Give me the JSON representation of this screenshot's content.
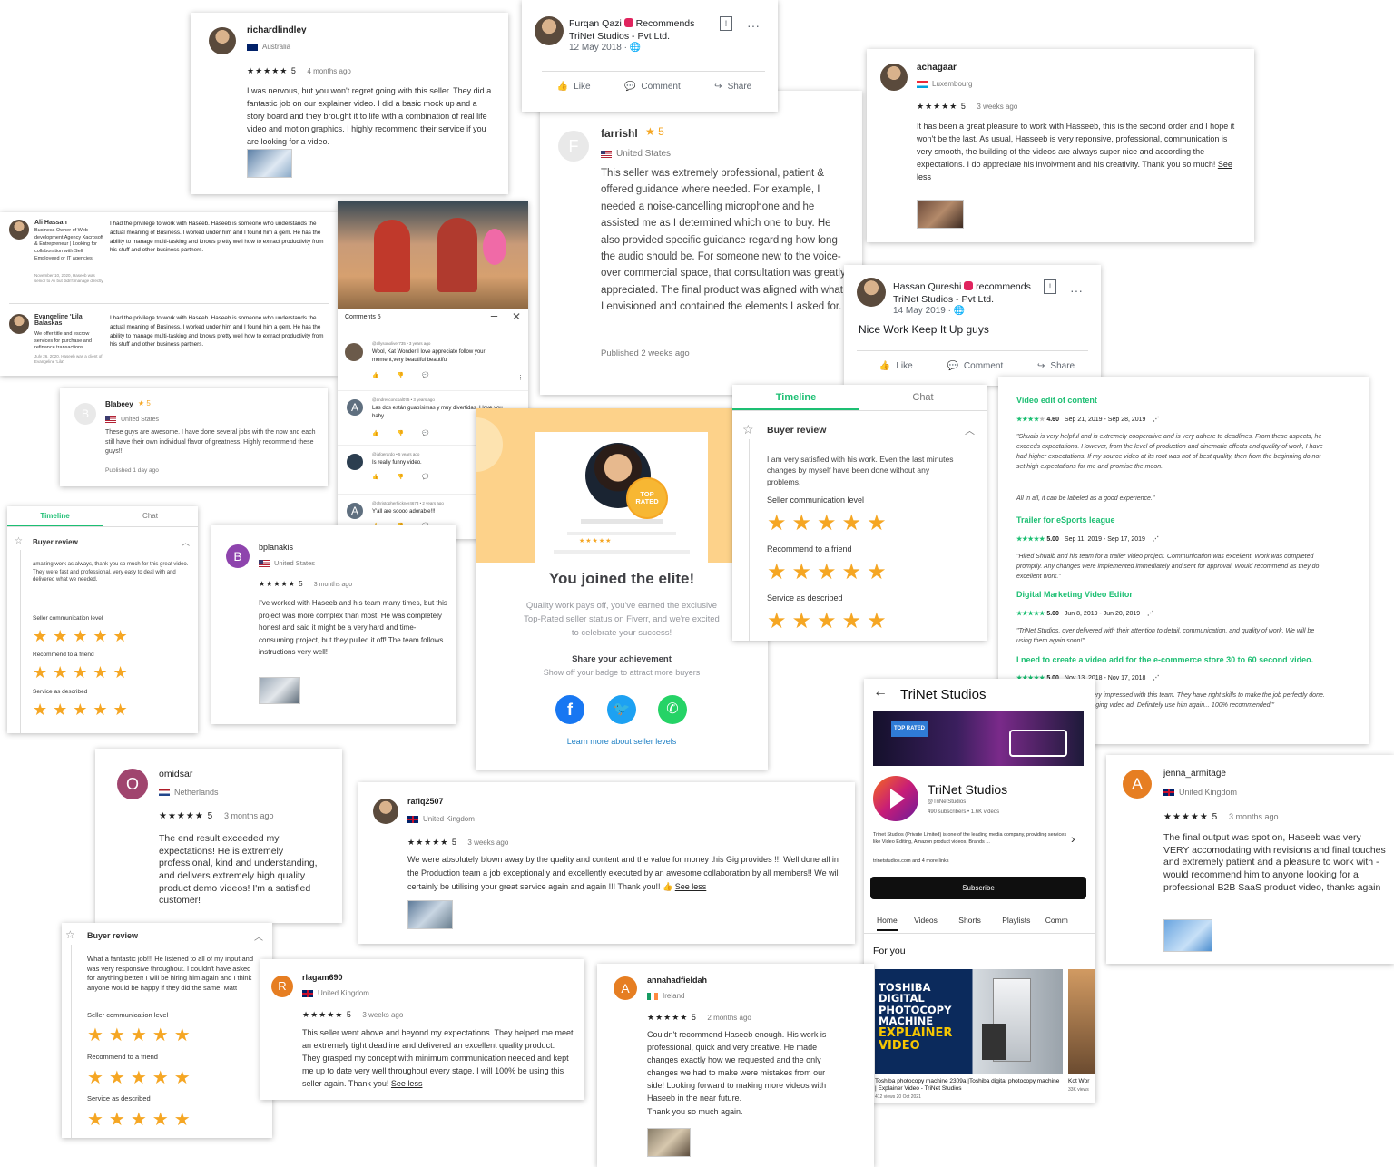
{
  "cards": {
    "richard": {
      "name": "richardlindley",
      "country": "Australia",
      "rating": "5",
      "when": "4 months ago",
      "text": "I was nervous, but you won't regret going with this seller. They did a fantastic job on our explainer video. I did a basic mock up and a story board and they brought it to life with a combination of real life video and motion graphics. I highly recommend their service if you are looking for a video."
    },
    "furqan": {
      "name": "Furqan Qazi",
      "recommends": "Recommends",
      "page": "TriNet Studios - Pvt Ltd.",
      "date": "12 May 2018",
      "like": "Like",
      "comment": "Comment",
      "share": "Share"
    },
    "achagaar": {
      "name": "achagaar",
      "country": "Luxembourg",
      "rating": "5",
      "when": "3 weeks ago",
      "text": "It has been a great pleasure to work with Hasseeb, this is the second order and I hope it won't be the last. As usual, Hasseeb is very reponsive, professional, communication is very smooth, the building of the videos are always super nice and according the expectations. I do appreciate his involvment and his creativity. Thank you so much!",
      "see_less": "See less"
    },
    "farrishl": {
      "avatar": "F",
      "name": "farrishl",
      "rating": "5",
      "country": "United States",
      "text": "This seller was extremely professional, patient & offered guidance where needed. For example, I needed a noise-cancelling microphone and he assisted me as I determined which one to buy. He also provided specific guidance regarding how long the audio should be. For someone new to the voice-over commercial space, that consultation was greatly appreciated. The final product was aligned with what I envisioned and contained the elements I asked for.",
      "published": "Published 2 weeks ago"
    },
    "linkedin": {
      "r1_name": "Ali Hassan",
      "r1_title": "Business Owner of Web development Agency Xacrosoft & Entrepreneur | Looking for collaboration with Self Employeed or IT agencies",
      "r1_meta": "November 10, 2020, Haseeb was senior to Ali but didn't manage directly",
      "r1_text": "I had the privilege to work with Haseeb. Haseeb is someone who understands the actual meaning of Business. I worked under him and I found him a gem. He has the ability to manage multi-tasking and knows pretty well how to extract productivity from his stuff and other business partners.",
      "r2_name": "Evangeline 'Lila' Balaskas",
      "r2_title": "We offer title and escrow services for purchase and refinance transactions.",
      "r2_meta": "July 26, 2020, Haseeb was a client of Evangeline 'Lila'",
      "r2_text": "I had the privilege to work with Haseeb. Haseeb is someone who understands the actual meaning of Business. I worked under him and I found him a gem. He has the ability to manage multi-tasking and knows pretty well how to extract productivity from his stuff and other business partners."
    },
    "comments": {
      "header": "Comments",
      "count": "5",
      "items": [
        {
          "user": "@allysonoliver735 • 3 years ago",
          "text": "Wool, Kat Wonder I love appreciate follow your moment,very beautiful beautiful"
        },
        {
          "user": "@andresconcoal075 • 3 years ago",
          "text": "Las dos están guapísimas y muy divertidas. I love you baby"
        },
        {
          "user": "@jafgerardo • 5 years ago",
          "text": "Is really funny video."
        },
        {
          "user": "@christopherhickner4673 • 2 years ago",
          "text": "Y'all are soooo adorable!!!"
        }
      ]
    },
    "hassan": {
      "name": "Hassan Qureshi",
      "recommends": "recommends",
      "page": "TriNet Studios - Pvt Ltd.",
      "date": "14 May 2019",
      "text": "Nice Work Keep It Up guys",
      "like": "Like",
      "comment": "Comment",
      "share": "Share"
    },
    "blabeey": {
      "avatar": "B",
      "name": "Blabeey",
      "rating": "5",
      "country": "United States",
      "text": "These guys are awesome. I have done several jobs with the now and each still have their own individual flavor of greatness. Highly recommend these guys!!",
      "published": "Published 1 day ago"
    },
    "fiverr_small": {
      "tab_timeline": "Timeline",
      "tab_chat": "Chat",
      "section": "Buyer review",
      "text": "amazing work as always, thank you so much for this great video. They were fast and professional, very easy to deal with and delivered what we needed.",
      "l1": "Seller communication level",
      "l2": "Recommend to a friend",
      "l3": "Service as described"
    },
    "bplanakis": {
      "avatar": "B",
      "name": "bplanakis",
      "country": "United States",
      "rating": "5",
      "when": "3 months ago",
      "text": "I've worked with Haseeb and his team many times, but this project was more complex than most. He was completely honest and said it might be a very hard and time-consuming project, but they pulled it off! The team follows instructions very well!"
    },
    "elite": {
      "badge": "TOP RATED",
      "title": "You joined the elite!",
      "desc": "Quality work pays off, you've earned the exclusive Top-Rated seller status on Fiverr, and we're excited to celebrate your success!",
      "share_title": "Share your achievement",
      "share_desc": "Show off your badge to attract more buyers",
      "learn": "Learn more about seller levels"
    },
    "fiverr_big": {
      "tab_timeline": "Timeline",
      "tab_chat": "Chat",
      "section": "Buyer review",
      "text": "I am very satisfied with his work. Even the last minutes changes by myself have been done without any problems.",
      "l1": "Seller communication level",
      "l2": "Recommend to a friend",
      "l3": "Service as described"
    },
    "upwork": {
      "t1": "Video edit of content",
      "s1": "4.60",
      "d1": "Sep 21, 2019 - Sep 28, 2019",
      "r1": "\"Shuaib is very helpful and is extremely cooperative and is very adhere to deadlines. From these aspects, he exceeds expectations. However, from the level of production and cinematic effects and quality of work, I have had higher expectations. If my source video at its root was not of best quality, then from the beginning do not set high expectations for me and promise the moon.",
      "r1b": "All in all, it can be labeled as a good experience.\"",
      "t2": "Trailer for eSports league",
      "s2": "5.00",
      "d2": "Sep 11, 2019 - Sep 17, 2019",
      "r2": "\"Hired Shuaib and his team for a trailer video project. Communication was excellent. Work was completed promptly. Any changes were implemented immediately and sent for approval. Would recommend as they do excellent work.\"",
      "t3": "Digital Marketing Video Editor",
      "s3": "5.00",
      "d3": "Jun 8, 2019 - Jun 20, 2019",
      "r3": "\"TriNet Studios, over delivered with their attention to detail, communication, and quality of work. We will be using them again soon!\"",
      "t4": "I need to create a video add for the e-commerce store 30 to 60 second video.",
      "s4": "5.00",
      "d4": "Nov 13, 2018 - Nov 17, 2018",
      "r4": "\"Thank you so much.i am very impressed with this team. They have right skills to make the job perfectly done. Very happy with highly engaging video ad. Definitely use him again... 100% recommended!\""
    },
    "omidsar": {
      "avatar": "O",
      "name": "omidsar",
      "country": "Netherlands",
      "rating": "5",
      "when": "3 months ago",
      "text": "The end result exceeded my expectations! He is extremely professional, kind and understanding, and delivers extremely high quality product demo videos! I'm a satisfied customer!"
    },
    "rafiq": {
      "name": "rafiq2507",
      "country": "United Kingdom",
      "rating": "5",
      "when": "3 weeks ago",
      "text": "We were absolutely blown away by the quality and content and the value for money this Gig provides !!! Well done all in the Production team a job exceptionally and excellently executed by an awesome collaboration by all members!! We will certainly be utilising your great service again and again !!! Thank you!!",
      "see_less": "See less"
    },
    "youtube": {
      "back_title": "TriNet Studios",
      "banner_badge": "TOP RATED",
      "channel": "TriNet Studios",
      "handle": "@TriNetStudios",
      "stats": "490 subscribers • 1.6K videos",
      "desc": "Trinet Studios (Private Limited) is one of the leading media company, providing services like Video Editing, Amazon product videos, Brands ...",
      "links": "trinetstudios.com and 4 more links",
      "subscribe": "Subscribe",
      "tabs": [
        "Home",
        "Videos",
        "Shorts",
        "Playlists",
        "Comm"
      ],
      "for_you": "For you",
      "thumb_text": [
        "TOSHIBA",
        "DIGITAL",
        "PHOTOCOPY",
        "MACHINE",
        "EXPLAINER",
        "VIDEO"
      ],
      "video_title": "Toshiba photocopy machine 2309a |Toshiba digital photocopy machine | Explainer Video - TriNet Studios",
      "video_meta": "412 views  20 Oct 2021",
      "video2_title": "Kot Wor",
      "video2_meta": "33K views"
    },
    "jenna": {
      "avatar": "A",
      "name": "jenna_armitage",
      "country": "United Kingdom",
      "rating": "5",
      "when": "3 months ago",
      "text": "The final output was spot on, Haseeb was very VERY accomodating with revisions and final touches and extremely patient and a pleasure to work with - would recommend him to anyone looking for a professional B2B SaaS product video, thanks again"
    },
    "fiverr_left": {
      "section": "Buyer review",
      "text": "What a fantastic job!!! He listened to all of my input and was very responsive throughout. I couldn't have asked for anything better! I will be hiring him again and I think anyone would be happy if they did the same. Matt",
      "l1": "Seller communication level",
      "l2": "Recommend to a friend",
      "l3": "Service as described"
    },
    "rlagam": {
      "avatar": "R",
      "name": "rlagam690",
      "country": "United Kingdom",
      "rating": "5",
      "when": "3 weeks ago",
      "text": "This seller went above and beyond my expectations. They helped me meet an extremely tight deadline and delivered an excellent quality product. They grasped my concept with minimum communication needed and kept me up to date very well throughout every stage. I will 100% be using this seller again. Thank you!",
      "see_less": "See less"
    },
    "anna": {
      "avatar": "A",
      "name": "annahadfieldah",
      "country": "Ireland",
      "rating": "5",
      "when": "2 months ago",
      "text": "Couldn't recommend Haseeb enough. His work is professional, quick and very creative. He made changes exactly how we requested and the only changes we had to make were mistakes from our side! Looking forward to making more videos with Haseeb in the near future.",
      "thanks": "Thank you so much again."
    }
  },
  "colors": {
    "fiverr_green": "#1dbf73",
    "star_orange": "#f5a623",
    "facebook": "#1877f2",
    "twitter": "#1da1f2",
    "whatsapp": "#25d366"
  }
}
